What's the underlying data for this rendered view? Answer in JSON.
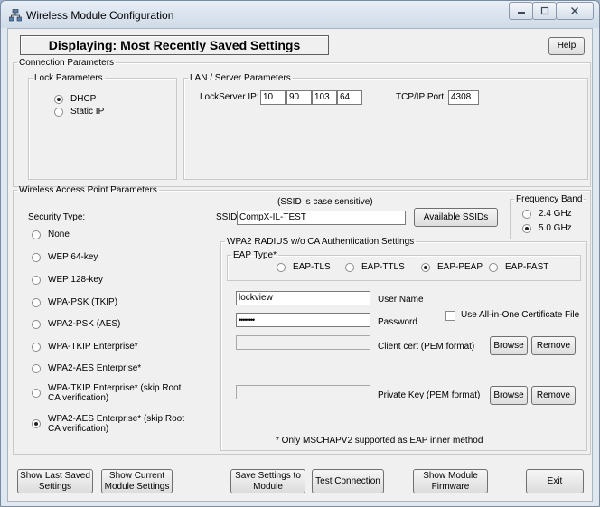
{
  "window": {
    "title": "Wireless Module Configuration",
    "minimize_icon": "minimize-icon",
    "maximize_icon": "maximize-icon",
    "close_icon": "close-icon"
  },
  "header": {
    "status": "Displaying: Most Recently Saved Settings",
    "help_label": "Help"
  },
  "connection": {
    "legend": "Connection Parameters",
    "lock": {
      "legend": "Lock Parameters",
      "options": [
        "DHCP",
        "Static IP"
      ],
      "selected": "DHCP"
    },
    "lan": {
      "legend": "LAN / Server Parameters",
      "ip_label": "LockServer IP:",
      "ip": [
        "10",
        "90",
        "103",
        "64"
      ],
      "port_label": "TCP/IP Port:",
      "port": "4308"
    }
  },
  "wireless": {
    "legend": "Wireless Access Point Parameters",
    "security_label": "Security Type:",
    "security_options": [
      "None",
      "WEP 64-key",
      "WEP 128-key",
      "WPA-PSK (TKIP)",
      "WPA2-PSK (AES)",
      "WPA-TKIP Enterprise*",
      "WPA2-AES Enterprise*",
      "WPA-TKIP Enterprise* (skip Root CA verification)",
      "WPA2-AES Enterprise* (skip Root CA verification)"
    ],
    "security_selected": "WPA2-AES Enterprise* (skip Root CA verification)",
    "ssid_note": "(SSID is case sensitive)",
    "ssid_label": "SSID:",
    "ssid_value": "CompX-IL-TEST",
    "available_ssids_label": "Available SSIDs",
    "frequency": {
      "legend": "Frequency Band",
      "options": [
        "2.4 GHz",
        "5.0 GHz"
      ],
      "selected": "5.0 GHz"
    },
    "radius": {
      "legend": "WPA2 RADIUS w/o CA Authentication Settings",
      "eap_legend": "EAP Type*",
      "eap_options": [
        "EAP-TLS",
        "EAP-TTLS",
        "EAP-PEAP",
        "EAP-FAST"
      ],
      "eap_selected": "EAP-PEAP",
      "username_value": "lockview",
      "username_label": "User Name",
      "password_value": "••••••••",
      "password_label": "Password",
      "all_in_one_label": "Use All-in-One Certificate File",
      "all_in_one_checked": false,
      "client_cert_value": "",
      "client_cert_label": "Client cert (PEM format)",
      "private_key_value": "",
      "private_key_label": "Private Key (PEM format)",
      "browse_label": "Browse",
      "remove_label": "Remove",
      "footnote": "* Only MSCHAPV2 supported as EAP inner method"
    }
  },
  "footer": {
    "show_last_saved": "Show Last Saved Settings",
    "show_current": "Show Current Module Settings",
    "save_to_module": "Save Settings to Module",
    "test_connection": "Test Connection",
    "show_firmware": "Show Module Firmware",
    "exit": "Exit"
  }
}
